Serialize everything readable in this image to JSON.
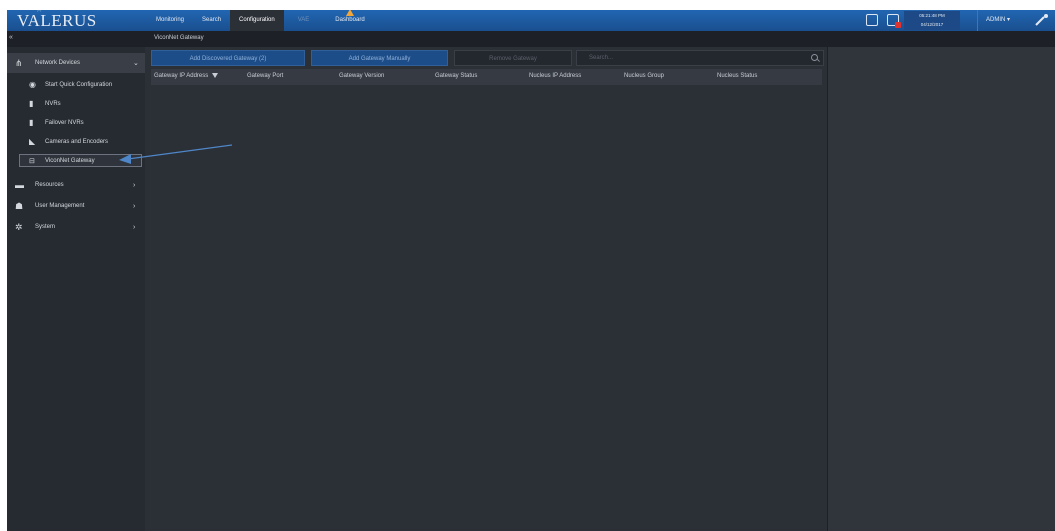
{
  "app": {
    "logo": "VALERUS"
  },
  "nav": {
    "items": [
      "Monitoring",
      "Search",
      "Configuration",
      "VAE",
      "Dashboard"
    ]
  },
  "topbar": {
    "time": "05:21:48 PM",
    "date": "04/12/2017",
    "user": "ADMIN ▾"
  },
  "breadcrumb": "ViconNet Gateway",
  "sidebar": {
    "header": "Network Devices",
    "items": [
      {
        "label": "Start Quick Configuration",
        "icon": "settings-circle-icon"
      },
      {
        "label": "NVRs",
        "icon": "server-icon"
      },
      {
        "label": "Failover NVRs",
        "icon": "failover-server-icon"
      },
      {
        "label": "Cameras and Encoders",
        "icon": "camera-icon"
      },
      {
        "label": "ViconNet Gateway",
        "icon": "gateway-icon"
      }
    ],
    "sections": [
      {
        "label": "Resources",
        "icon": "folder-icon"
      },
      {
        "label": "User Management",
        "icon": "user-icon"
      },
      {
        "label": "System",
        "icon": "gear-icon"
      }
    ]
  },
  "toolbar": {
    "add_discovered": "Add Discovered Gateway (2)",
    "add_manual": "Add Gateway Manually",
    "remove": "Remove Gateway",
    "search_placeholder": "Search..."
  },
  "table": {
    "columns": [
      "Gateway IP Address",
      "Gateway Port",
      "Gateway Version",
      "Gateway Status",
      "Nucleus IP Address",
      "Nucleus Group",
      "Nucleus Status"
    ]
  },
  "colors": {
    "topbar": "#1f5fa8",
    "accent_button": "#1d4d88",
    "background": "#262a31",
    "arrow": "#4f86c8"
  }
}
